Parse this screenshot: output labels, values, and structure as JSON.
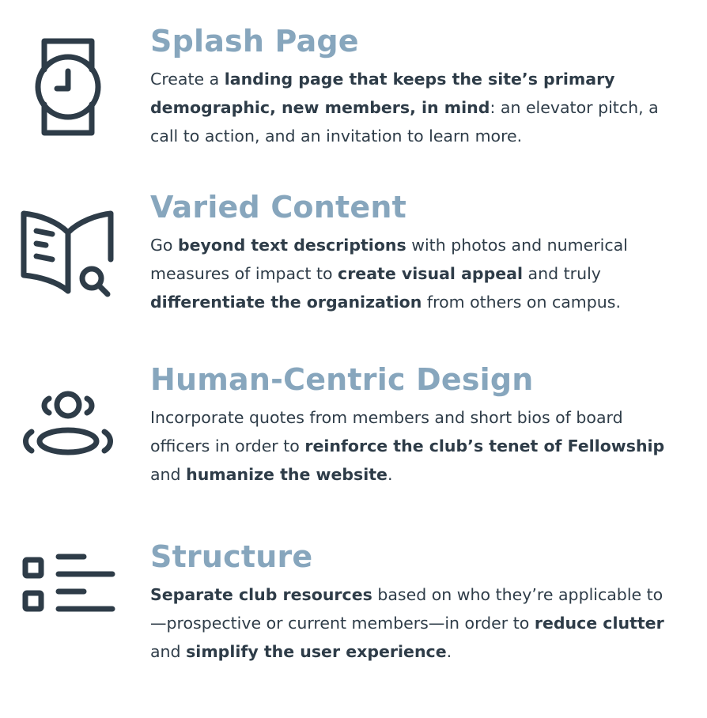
{
  "colors": {
    "heading": "#87a6bd",
    "body_text": "#2e3c48",
    "icon_stroke": "#2e3c48",
    "background": "#ffffff"
  },
  "features": [
    {
      "icon": "watch-icon",
      "title": "Splash Page",
      "body": [
        {
          "text": "Create a ",
          "bold": false
        },
        {
          "text": "landing page that keeps the site’s primary demographic, new members, in mind",
          "bold": true
        },
        {
          "text": ": an elevator pitch, a call to action, and an invitation to learn more.",
          "bold": false
        }
      ]
    },
    {
      "icon": "book-search-icon",
      "title": "Varied Content",
      "body": [
        {
          "text": "Go ",
          "bold": false
        },
        {
          "text": "beyond text descriptions",
          "bold": true
        },
        {
          "text": " with photos and numerical measures of impact to ",
          "bold": false
        },
        {
          "text": "create visual appeal",
          "bold": true
        },
        {
          "text": " and truly ",
          "bold": false
        },
        {
          "text": "differentiate the organization",
          "bold": true
        },
        {
          "text": " from others on campus.",
          "bold": false
        }
      ]
    },
    {
      "icon": "user-circle-icon",
      "title": "Human-Centric Design",
      "body": [
        {
          "text": "Incorporate quotes from members and short bios of board officers in order to ",
          "bold": false
        },
        {
          "text": "reinforce the club’s tenet of Fellowship",
          "bold": true
        },
        {
          "text": " and ",
          "bold": false
        },
        {
          "text": "humanize the website",
          "bold": true
        },
        {
          "text": ".",
          "bold": false
        }
      ]
    },
    {
      "icon": "list-icon",
      "title": "Structure",
      "body": [
        {
          "text": "Separate club resources",
          "bold": true
        },
        {
          "text": " based on who they’re applicable to—prospective or current members—in order to ",
          "bold": false
        },
        {
          "text": "reduce clutter",
          "bold": true
        },
        {
          "text": " and ",
          "bold": false
        },
        {
          "text": "simplify the user experience",
          "bold": true
        },
        {
          "text": ".",
          "bold": false
        }
      ]
    }
  ]
}
